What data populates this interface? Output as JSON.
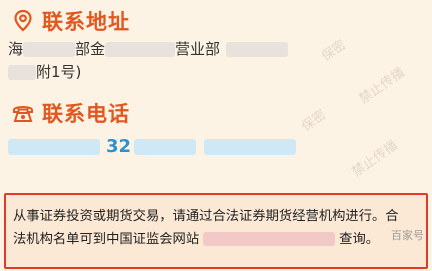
{
  "contact": {
    "address_title": "联系地址",
    "address_line1_a": "海",
    "address_line1_b": "部金",
    "address_line1_c": "营业部",
    "address_line2_tail": "附1号)",
    "phone_title": "联系电话",
    "phone_visible_digits": "32"
  },
  "watermark": {
    "text1": "保密",
    "text2": "禁止传播",
    "text3": "保密",
    "text4": "禁止传播"
  },
  "notice": {
    "line1": "从事证券投资或期货交易，请通过合法证券期货经营机构进行。合",
    "line2_prefix": "法机构名单可到中国证监会网站",
    "line2_suffix": "查询。"
  },
  "credit": "百家号"
}
